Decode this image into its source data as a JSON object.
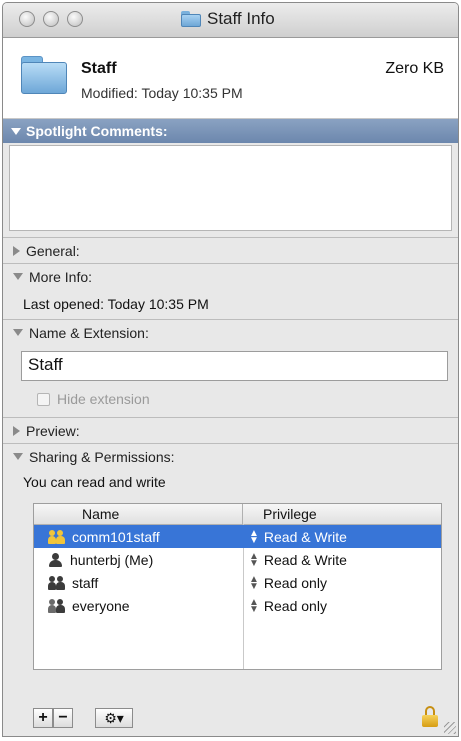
{
  "window": {
    "title": "Staff Info"
  },
  "item": {
    "name": "Staff",
    "size": "Zero KB",
    "modified": "Modified: Today 10:35 PM"
  },
  "spotlight": {
    "label": "Spotlight Comments:"
  },
  "sections": {
    "general": "General:",
    "more_info": "More Info:",
    "last_opened": "Last opened: Today 10:35 PM",
    "name_extension": "Name & Extension:",
    "name_value": "Staff",
    "hide_extension": "Hide extension",
    "preview": "Preview:",
    "sharing": "Sharing & Permissions:",
    "access_summary": "You can read and write"
  },
  "permissions": {
    "col_name": "Name",
    "col_privilege": "Privilege",
    "rows": [
      {
        "name": "comm101staff",
        "privilege": "Read & Write",
        "icon": "group-icon"
      },
      {
        "name": "hunterbj (Me)",
        "privilege": "Read & Write",
        "icon": "user-icon"
      },
      {
        "name": "staff",
        "privilege": "Read only",
        "icon": "group-icon"
      },
      {
        "name": "everyone",
        "privilege": "Read only",
        "icon": "everyone-icon"
      }
    ]
  },
  "toolbar": {
    "add": "+",
    "remove": "−",
    "action": "⚙▾"
  },
  "colors": {
    "selection": "#3875d7",
    "spotlight_bar": "#7c95b8"
  }
}
